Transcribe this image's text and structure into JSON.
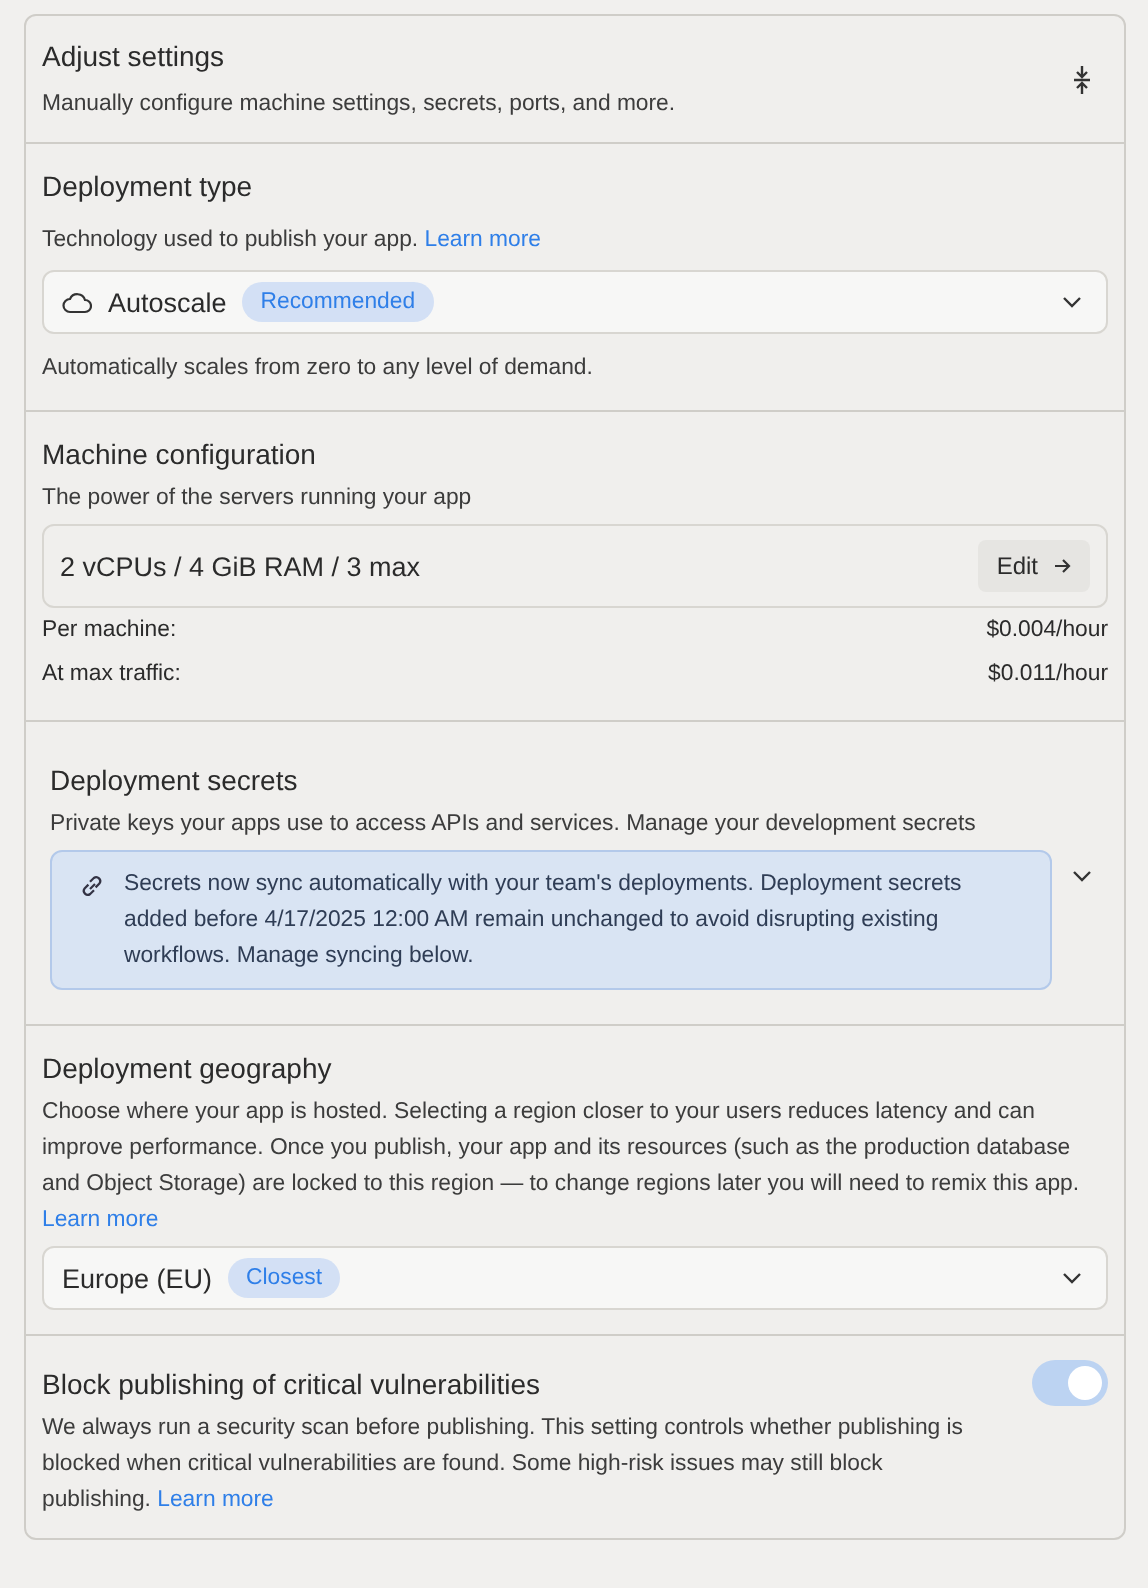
{
  "header": {
    "title": "Adjust settings",
    "subtitle": "Manually configure machine settings, secrets, ports, and more."
  },
  "deployment_type": {
    "title": "Deployment type",
    "description": "Technology used to publish your app.",
    "link": "Learn more",
    "select": {
      "value": "Autoscale",
      "badge": "Recommended"
    },
    "note": "Automatically scales from zero to any level of demand."
  },
  "machine": {
    "title": "Machine configuration",
    "description": "The power of the servers running your app",
    "config": "2 vCPUs / 4 GiB RAM / 3 max",
    "edit_button": "Edit",
    "costs": [
      {
        "label": "Per machine:",
        "value": "$0.004/hour"
      },
      {
        "label": "At max traffic:",
        "value": "$0.011/hour"
      }
    ]
  },
  "secrets": {
    "title": "Deployment secrets",
    "description": "Private keys your apps use to access APIs and services. Manage your development secrets",
    "notice": "Secrets now sync automatically with your team's deployments. Deployment secrets added before 4/17/2025 12:00 AM remain unchanged to avoid disrupting existing workflows. Manage syncing below."
  },
  "geography": {
    "title": "Deployment geography",
    "description": "Choose where your app is hosted. Selecting a region closer to your users reduces latency and can improve performance. Once you publish, your app and its resources (such as the production database and Object Storage) are locked to this region — to change regions later you will need to remix this app.",
    "link": "Learn more",
    "select": {
      "value": "Europe (EU)",
      "badge": "Closest"
    }
  },
  "block_publishing": {
    "title": "Block publishing of critical vulnerabilities",
    "description": "We always run a security scan before publishing. This setting controls whether publishing is blocked when critical vulnerabilities are found. Some high-risk issues may still block publishing.",
    "link": "Learn more",
    "toggle": {
      "on": true
    }
  }
}
